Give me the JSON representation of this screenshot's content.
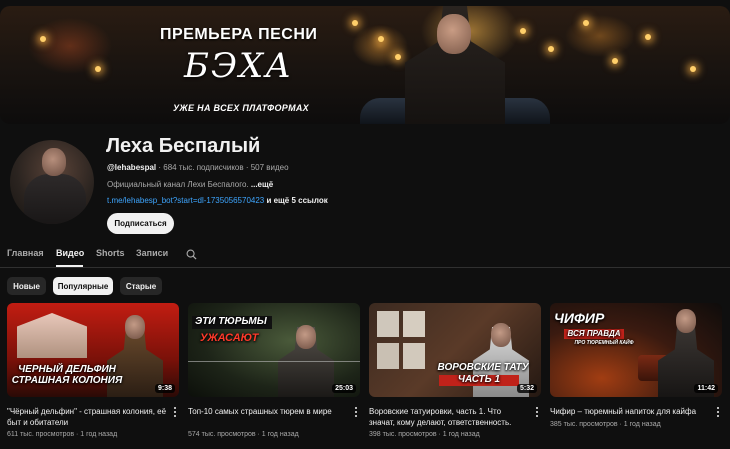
{
  "banner": {
    "line1": "ПРЕМЬЕРА ПЕСНИ",
    "line2": "БЭХА",
    "line3": "УЖЕ НА ВСЕХ ПЛАТФОРМАХ"
  },
  "channel": {
    "name": "Леха Беспалый",
    "handle": "@lehabespal",
    "stats": " · 684 тыс. подписчиков · 507 видео",
    "description": "Официальный канал Лехи Беспалого. ",
    "description_more": "...ещё",
    "link_url": "t.me/lehabesp_bot?start=dl-1735056570423",
    "link_extra": " и ещё 5 ссылок",
    "subscribe_label": "Подписаться"
  },
  "tabs": [
    {
      "label": "Главная"
    },
    {
      "label": "Видео"
    },
    {
      "label": "Shorts"
    },
    {
      "label": "Записи"
    }
  ],
  "active_tab": "Видео",
  "chips": [
    {
      "label": "Новые"
    },
    {
      "label": "Популярные"
    },
    {
      "label": "Старые"
    }
  ],
  "active_chip": "Популярные",
  "videos": [
    {
      "title": "\"Чёрный дельфин\" - страшная колония, её быт и обитатели",
      "meta": "611 тыс. просмотров · 1 год назад",
      "duration": "9:38",
      "caption1": "ЧЕРНЫЙ ДЕЛЬФИН",
      "caption2": "СТРАШНАЯ КОЛОНИЯ"
    },
    {
      "title": "Топ-10 самых страшных тюрем в мире",
      "meta": "574 тыс. просмотров · 1 год назад",
      "duration": "25:03",
      "caption1": "ЭТИ ТЮРЬМЫ",
      "caption2": "УЖАСАЮТ"
    },
    {
      "title": "Воровские татуировки, часть 1. Что значат, кому делают, ответственность.",
      "meta": "398 тыс. просмотров · 1 год назад",
      "duration": "5:32",
      "caption1": "ВОРОВСКИЕ ТАТУ",
      "caption2": "ЧАСТЬ 1"
    },
    {
      "title": "Чифир – тюремный напиток для кайфа",
      "meta": "385 тыс. просмотров · 1 год назад",
      "duration": "11:42",
      "caption1": "ЧИФИР",
      "caption2": "ВСЯ ПРАВДА",
      "caption3": "ПРО ТЮРЕМНЫЙ КАЙФ"
    }
  ]
}
